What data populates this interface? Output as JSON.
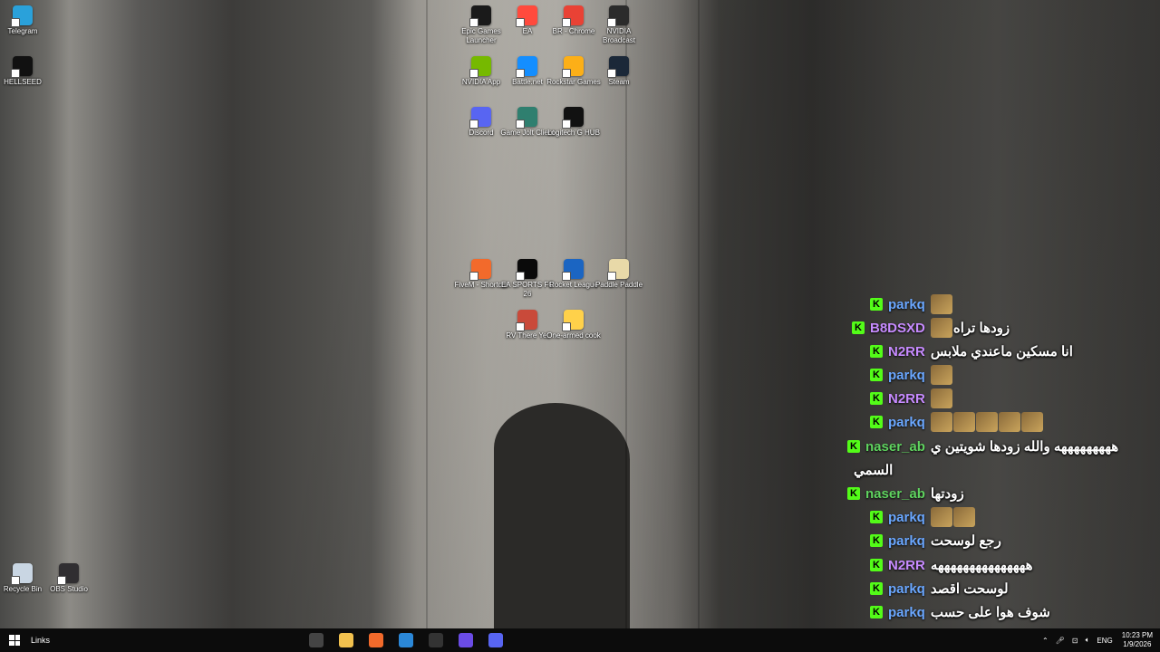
{
  "desktop": {
    "icons": [
      {
        "label": "Telegram",
        "icon": "telegram-icon",
        "color": "#2aa1da"
      },
      {
        "label": "HELLSEED",
        "icon": "hellseed-icon",
        "color": "#111111"
      },
      {
        "label": "Epic Games Launcher",
        "icon": "epic-games-icon",
        "color": "#1a1a1a"
      },
      {
        "label": "EA",
        "icon": "ea-icon",
        "color": "#ff4a3d"
      },
      {
        "label": "BR - Chrome",
        "icon": "chrome-icon",
        "color": "#e94235"
      },
      {
        "label": "NVIDIA Broadcast",
        "icon": "nvidia-broadcast-icon",
        "color": "#2b2b2b"
      },
      {
        "label": "NVIDIA App",
        "icon": "nvidia-app-icon",
        "color": "#76b900"
      },
      {
        "label": "Battle.net",
        "icon": "battlenet-icon",
        "color": "#148eff"
      },
      {
        "label": "Rockstar Games",
        "icon": "rockstar-icon",
        "color": "#fcaf17"
      },
      {
        "label": "Steam",
        "icon": "steam-icon",
        "color": "#1b2838"
      },
      {
        "label": "Discord",
        "icon": "discord-icon",
        "color": "#5865f2"
      },
      {
        "label": "Game Jolt Client",
        "icon": "gamejolt-icon",
        "color": "#2f7f6f"
      },
      {
        "label": "Logitech G HUB",
        "icon": "logitech-icon",
        "color": "#111111"
      },
      {
        "label": "FiveM - Shortcut",
        "icon": "fivem-icon",
        "color": "#f26a2b"
      },
      {
        "label": "EA SPORTS FC 26",
        "icon": "eafc-icon",
        "color": "#0a0a0a"
      },
      {
        "label": "Rocket League",
        "icon": "rocket-league-icon",
        "color": "#1b65c2"
      },
      {
        "label": "Paddle Paddle",
        "icon": "paddle-icon",
        "color": "#e8d9a8"
      },
      {
        "label": "RV There Yet",
        "icon": "rv-icon",
        "color": "#c94a3a"
      },
      {
        "label": "One-armed cook",
        "icon": "cook-icon",
        "color": "#ffd14a"
      },
      {
        "label": "Recycle Bin",
        "icon": "recycle-bin-icon",
        "color": "#c9d6e3"
      },
      {
        "label": "OBS Studio",
        "icon": "obs-icon",
        "color": "#302e31"
      }
    ]
  },
  "chat": {
    "accent": "#53fc18",
    "badge": "K",
    "messages": [
      {
        "user": "parkq",
        "color": "#6aa7ff",
        "text": "",
        "emotes": 1
      },
      {
        "user": "B8DSXD",
        "color": "#c78bff",
        "text": "زودها تراه",
        "emotes": 1
      },
      {
        "user": "N2RR",
        "color": "#c78bff",
        "text": "انا مسكين ماعندي ملابس",
        "emotes": 0
      },
      {
        "user": "parkq",
        "color": "#6aa7ff",
        "text": "",
        "emotes": 1
      },
      {
        "user": "N2RR",
        "color": "#c78bff",
        "text": "",
        "emotes": 1
      },
      {
        "user": "parkq",
        "color": "#6aa7ff",
        "text": "",
        "emotes": 5
      },
      {
        "user": "naser_ab",
        "color": "#5fd35f",
        "text": "هههههههههه والله زودها شويتين ي",
        "emotes": 0
      },
      {
        "user": "",
        "color": "#5fd35f",
        "text": "السمي",
        "emotes": 0
      },
      {
        "user": "naser_ab",
        "color": "#5fd35f",
        "text": "زودتها",
        "emotes": 0
      },
      {
        "user": "parkq",
        "color": "#6aa7ff",
        "text": "",
        "emotes": 2
      },
      {
        "user": "parkq",
        "color": "#6aa7ff",
        "text": "رجع لوسحت",
        "emotes": 0
      },
      {
        "user": "N2RR",
        "color": "#c78bff",
        "text": "هههههههههههههههه",
        "emotes": 0
      },
      {
        "user": "parkq",
        "color": "#6aa7ff",
        "text": "لوسحت اقصد",
        "emotes": 0
      },
      {
        "user": "parkq",
        "color": "#6aa7ff",
        "text": "شوف هوا على حسب",
        "emotes": 0
      }
    ]
  },
  "taskbar": {
    "links_label": "Links",
    "apps": [
      {
        "icon": "settings-icon",
        "color": "#444444"
      },
      {
        "icon": "file-explorer-icon",
        "color": "#f2c14e"
      },
      {
        "icon": "fivem-icon",
        "color": "#f26a2b"
      },
      {
        "icon": "microsoft-store-icon",
        "color": "#2b88d8"
      },
      {
        "icon": "bm-icon",
        "color": "#333333"
      },
      {
        "icon": "kick-studio-icon",
        "color": "#6b4ce6"
      },
      {
        "icon": "discord-icon",
        "color": "#5865f2"
      }
    ],
    "tray": {
      "language": "ENG",
      "time": "10:23 PM",
      "date": "1/9/2026"
    }
  }
}
